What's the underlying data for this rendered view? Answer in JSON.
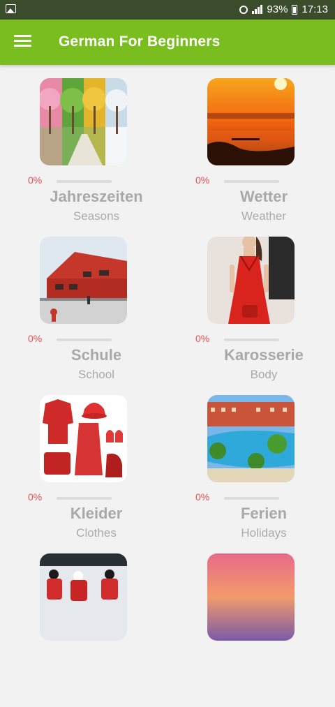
{
  "status_bar": {
    "battery": "93%",
    "time": "17:13"
  },
  "app_bar": {
    "title": "German For Beginners"
  },
  "colors": {
    "accent": "#79bd1f",
    "status_bar": "#3b4c2d",
    "percent_text": "#e05050"
  },
  "topics": [
    {
      "title": "Jahreszeiten",
      "subtitle": "Seasons",
      "progress_label": "0%",
      "progress": 0,
      "image": "four-seasons-trees"
    },
    {
      "title": "Wetter",
      "subtitle": "Weather",
      "progress_label": "0%",
      "progress": 0,
      "image": "sunset-over-water"
    },
    {
      "title": "Schule",
      "subtitle": "School",
      "progress_label": "0%",
      "progress": 0,
      "image": "red-school-building"
    },
    {
      "title": "Karosserie",
      "subtitle": "Body",
      "progress_label": "0%",
      "progress": 0,
      "image": "woman-in-red-dress"
    },
    {
      "title": "Kleider",
      "subtitle": "Clothes",
      "progress_label": "0%",
      "progress": 0,
      "image": "red-clothing-items"
    },
    {
      "title": "Ferien",
      "subtitle": "Holidays",
      "progress_label": "0%",
      "progress": 0,
      "image": "resort-pool"
    },
    {
      "image": "hockey-players"
    },
    {
      "image": "pink-sky"
    }
  ]
}
